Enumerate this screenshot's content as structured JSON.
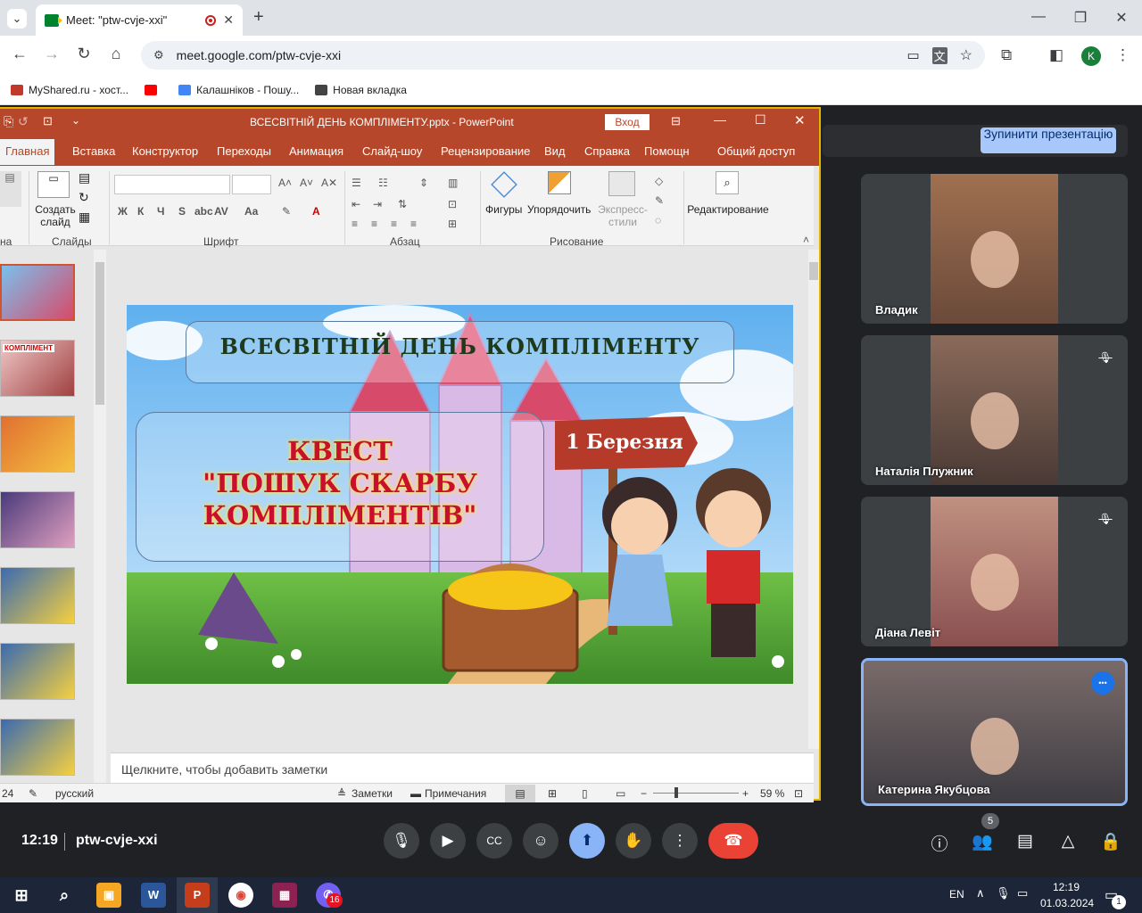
{
  "browser": {
    "tab_title": "Meet: \"ptw-cvje-xxi\"",
    "url": "meet.google.com/ptw-cvje-xxi",
    "new_tab": "+",
    "profile_initial": "K",
    "bookmarks": [
      {
        "label": "MyShared.ru - хост...",
        "color": "#c0392b"
      },
      {
        "label": "",
        "color": "#ff0000"
      },
      {
        "label": "Калашніков - Пошу...",
        "color": "#4285f4"
      },
      {
        "label": "Новая вкладка",
        "color": "#444444"
      }
    ]
  },
  "powerpoint": {
    "window_title": "ВСЕСВІТНІЙ ДЕНЬ КОМПЛІМЕНТУ.pptx  -  PowerPoint",
    "signin": "Вход",
    "tabs": [
      "Главная",
      "Вставка",
      "Конструктор",
      "Переходы",
      "Анимация",
      "Слайд-шоу",
      "Рецензирование",
      "Вид",
      "Справка",
      "Помощн",
      "Общий доступ"
    ],
    "ribbon": {
      "create_slide": "Создать слайд",
      "groups": {
        "slides": "Слайды",
        "font": "Шрифт",
        "paragraph": "Абзац",
        "drawing": "Рисование",
        "clipboard": "на"
      },
      "shapes": "Фигуры",
      "arrange": "Упорядочить",
      "quick_styles": "Экспресс-стили",
      "editing": "Редактирование",
      "font_buttons": [
        "Ж",
        "К",
        "Ч",
        "S",
        "abc",
        "AV",
        "Aa"
      ]
    },
    "slide": {
      "title": "ВСЕСВІТНІЙ ДЕНЬ КОМПЛІМЕНТУ",
      "quest_line1": "КВЕСТ",
      "quest_line2": "\"ПОШУК СКАРБУ",
      "quest_line3": "КОМПЛІМЕНТІВ\"",
      "date_sign": "1 Березня"
    },
    "notes_placeholder": "Щелкните, чтобы добавить заметки",
    "status": {
      "slide_count": "24",
      "language": "русский",
      "notes": "Заметки",
      "comments": "Примечания",
      "zoom": "59 %"
    },
    "thumb_labels": [
      "КОМПЛІМЕНТ"
    ]
  },
  "meet": {
    "stop_presenting": "Зупинити презентацію",
    "participants": [
      {
        "name": "Владик",
        "muted": false,
        "colors": [
          "#6b4a3a",
          "#a07050"
        ]
      },
      {
        "name": "Наталія Плужник",
        "muted": true,
        "colors": [
          "#4a3a35",
          "#8a6a5a"
        ]
      },
      {
        "name": "Діана Левіт",
        "muted": true,
        "colors": [
          "#8a5050",
          "#c09080"
        ]
      },
      {
        "name": "Катерина Якубцова",
        "muted": false,
        "colors": [
          "#3a3a40",
          "#7a6a6a"
        ]
      }
    ],
    "time": "12:19",
    "meeting_code": "ptw-cvje-xxi",
    "participant_count": "5"
  },
  "taskbar": {
    "lang": "EN",
    "time": "12:19",
    "date": "01.03.2024",
    "notification_count": "1",
    "viber_badge": "16"
  }
}
